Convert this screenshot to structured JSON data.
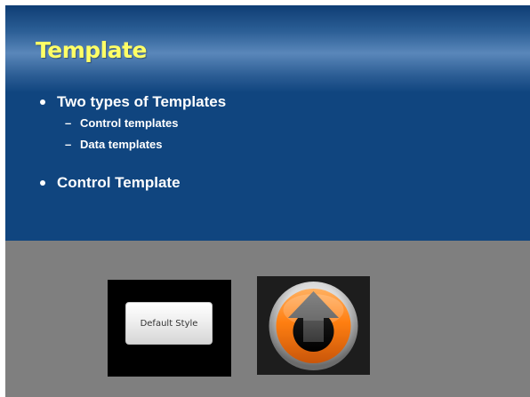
{
  "slide": {
    "title": "Template",
    "bullets": [
      {
        "text": "Two types of Templates",
        "sub": [
          "Control templates",
          "Data templates"
        ]
      },
      {
        "text": "Control Template",
        "sub": []
      }
    ],
    "sub_marker": "–"
  },
  "images": {
    "default_button_label": "Default Style",
    "custom_button_icon": "orange-up-arrow-icon"
  },
  "colors": {
    "title": "#ffff66",
    "content_background": "#10457f",
    "lower_background": "#7f7f7f",
    "orange_button": "#ff7f11"
  }
}
